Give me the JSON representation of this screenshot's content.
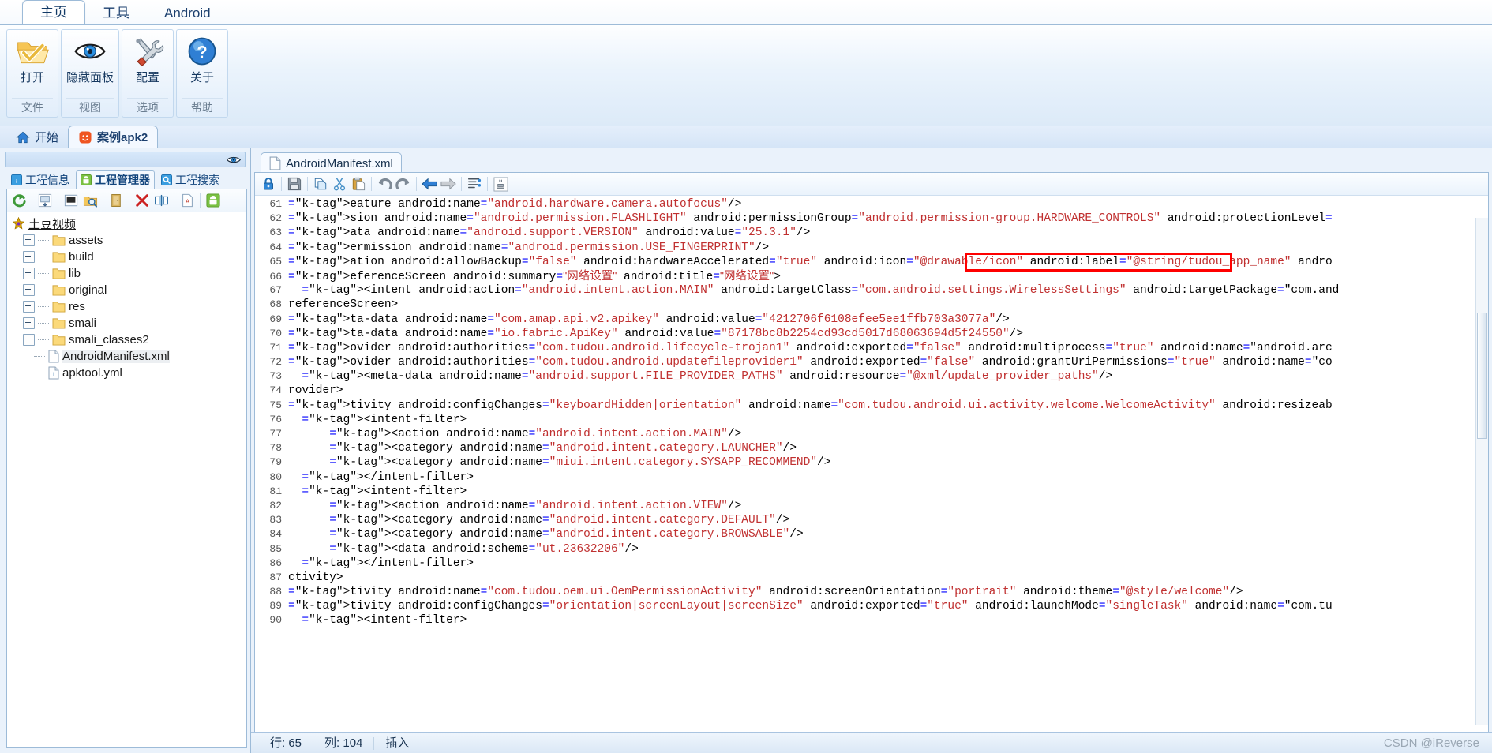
{
  "ribbon": {
    "tabs": [
      {
        "label": "主页",
        "active": true
      },
      {
        "label": "工具",
        "active": false
      },
      {
        "label": "Android",
        "active": false
      }
    ],
    "groups": [
      {
        "button_label": "打开",
        "icon": "open-folder-icon",
        "group_title": "文件"
      },
      {
        "button_label": "隐藏面板",
        "icon": "eye-icon",
        "group_title": "视图"
      },
      {
        "button_label": "配置",
        "icon": "tools-icon",
        "group_title": "选项"
      },
      {
        "button_label": "关于",
        "icon": "question-icon",
        "group_title": "帮助"
      }
    ]
  },
  "doc_tabs": [
    {
      "label": "开始",
      "icon": "home-icon",
      "active": false
    },
    {
      "label": "案例apk2",
      "icon": "apk-icon",
      "active": true
    }
  ],
  "left_panel": {
    "header_icon": "eye-icon",
    "tabs": [
      {
        "label": "工程信息",
        "icon": "info-icon",
        "active": false
      },
      {
        "label": "工程管理器",
        "icon": "android-icon",
        "active": true
      },
      {
        "label": "工程搜索",
        "icon": "search-icon",
        "active": false
      }
    ],
    "toolbar_icons": [
      "refresh-icon",
      "export-icon",
      "sep",
      "compile-icon",
      "find-in-files-icon",
      "sep",
      "door-icon",
      "sep",
      "delete-icon",
      "rename-icon",
      "sep",
      "text-file-icon",
      "sep",
      "android-build-icon"
    ],
    "tree": {
      "root": {
        "label": "土豆视频",
        "icon": "project-icon"
      },
      "nodes": [
        {
          "label": "assets",
          "type": "folder",
          "expandable": true,
          "selected": false
        },
        {
          "label": "build",
          "type": "folder",
          "expandable": true,
          "selected": false
        },
        {
          "label": "lib",
          "type": "folder",
          "expandable": true,
          "selected": false
        },
        {
          "label": "original",
          "type": "folder",
          "expandable": true,
          "selected": false
        },
        {
          "label": "res",
          "type": "folder",
          "expandable": true,
          "selected": false
        },
        {
          "label": "smali",
          "type": "folder",
          "expandable": true,
          "selected": false
        },
        {
          "label": "smali_classes2",
          "type": "folder",
          "expandable": true,
          "selected": false
        },
        {
          "label": "AndroidManifest.xml",
          "type": "file",
          "expandable": false,
          "selected": true
        },
        {
          "label": "apktool.yml",
          "type": "file-yml",
          "expandable": false,
          "selected": false
        }
      ]
    }
  },
  "editor": {
    "tab": {
      "label": "AndroidManifest.xml",
      "icon": "xml-file-icon"
    },
    "toolbar_icons": [
      "lock-icon",
      "sep",
      "save-icon",
      "sep",
      "copy-icon",
      "cut-icon",
      "paste-icon",
      "sep",
      "undo-icon",
      "redo-icon",
      "sep",
      "back-arrow-icon",
      "forward-arrow-icon",
      "sep",
      "format-icon",
      "sep",
      "java-icon"
    ],
    "first_line_number": 61,
    "lines": [
      {
        "n": 61,
        "text": "eature android:name=\"android.hardware.camera.autofocus\"/>"
      },
      {
        "n": 62,
        "text": "sion android:name=\"android.permission.FLASHLIGHT\" android:permissionGroup=\"android.permission-group.HARDWARE_CONTROLS\" android:protectionLevel="
      },
      {
        "n": 63,
        "text": "ata android:name=\"android.support.VERSION\" android:value=\"25.3.1\"/>"
      },
      {
        "n": 64,
        "text": "ermission android:name=\"android.permission.USE_FINGERPRINT\"/>"
      },
      {
        "n": 65,
        "text": "ation android:allowBackup=\"false\" android:hardwareAccelerated=\"true\" android:icon=\"@drawable/icon\" android:label=\"@string/tudou_app_name\" andro"
      },
      {
        "n": 66,
        "text": "eferenceScreen android:summary=\"网络设置\" android:title=\"网络设置\">"
      },
      {
        "n": 67,
        "text": "  <intent android:action=\"android.intent.action.MAIN\" android:targetClass=\"com.android.settings.WirelessSettings\" android:targetPackage=\"com.and"
      },
      {
        "n": 68,
        "text": "referenceScreen>"
      },
      {
        "n": 69,
        "text": "ta-data android:name=\"com.amap.api.v2.apikey\" android:value=\"4212706f6108efee5ee1ffb703a3077a\"/>"
      },
      {
        "n": 70,
        "text": "ta-data android:name=\"io.fabric.ApiKey\" android:value=\"87178bc8b2254cd93cd5017d68063694d5f24550\"/>"
      },
      {
        "n": 71,
        "text": "ovider android:authorities=\"com.tudou.android.lifecycle-trojan1\" android:exported=\"false\" android:multiprocess=\"true\" android:name=\"android.arc"
      },
      {
        "n": 72,
        "text": "ovider android:authorities=\"com.tudou.android.updatefileprovider1\" android:exported=\"false\" android:grantUriPermissions=\"true\" android:name=\"co"
      },
      {
        "n": 73,
        "text": "  <meta-data android:name=\"android.support.FILE_PROVIDER_PATHS\" android:resource=\"@xml/update_provider_paths\"/>"
      },
      {
        "n": 74,
        "text": "rovider>"
      },
      {
        "n": 75,
        "text": "tivity android:configChanges=\"keyboardHidden|orientation\" android:name=\"com.tudou.android.ui.activity.welcome.WelcomeActivity\" android:resizeab"
      },
      {
        "n": 76,
        "text": "  <intent-filter>"
      },
      {
        "n": 77,
        "text": "      <action android:name=\"android.intent.action.MAIN\"/>"
      },
      {
        "n": 78,
        "text": "      <category android:name=\"android.intent.category.LAUNCHER\"/>"
      },
      {
        "n": 79,
        "text": "      <category android:name=\"miui.intent.category.SYSAPP_RECOMMEND\"/>"
      },
      {
        "n": 80,
        "text": "  </intent-filter>"
      },
      {
        "n": 81,
        "text": "  <intent-filter>"
      },
      {
        "n": 82,
        "text": "      <action android:name=\"android.intent.action.VIEW\"/>"
      },
      {
        "n": 83,
        "text": "      <category android:name=\"android.intent.category.DEFAULT\"/>"
      },
      {
        "n": 84,
        "text": "      <category android:name=\"android.intent.category.BROWSABLE\"/>"
      },
      {
        "n": 85,
        "text": "      <data android:scheme=\"ut.23632206\"/>"
      },
      {
        "n": 86,
        "text": "  </intent-filter>"
      },
      {
        "n": 87,
        "text": "ctivity>"
      },
      {
        "n": 88,
        "text": "tivity android:name=\"com.tudou.oem.ui.OemPermissionActivity\" android:screenOrientation=\"portrait\" android:theme=\"@style/welcome\"/>"
      },
      {
        "n": 89,
        "text": "tivity android:configChanges=\"orientation|screenLayout|screenSize\" android:exported=\"true\" android:launchMode=\"singleTask\" android:name=\"com.tu"
      },
      {
        "n": 90,
        "text": "  <intent-filter>"
      }
    ],
    "highlight": {
      "line": 65,
      "text": "android:label=\"@string/tudou_app_name\"",
      "color": "#ff0000"
    }
  },
  "statusbar": {
    "row_label": "行: 65",
    "col_label": "列: 104",
    "mode_label": "插入"
  },
  "watermark": "CSDN @iReverse",
  "colors": {
    "accent": "#1b3f6e",
    "highlight": "#ff0000",
    "tag": "#0000c8",
    "string": "#c03030",
    "panel_bg": "#eaf2fb"
  }
}
